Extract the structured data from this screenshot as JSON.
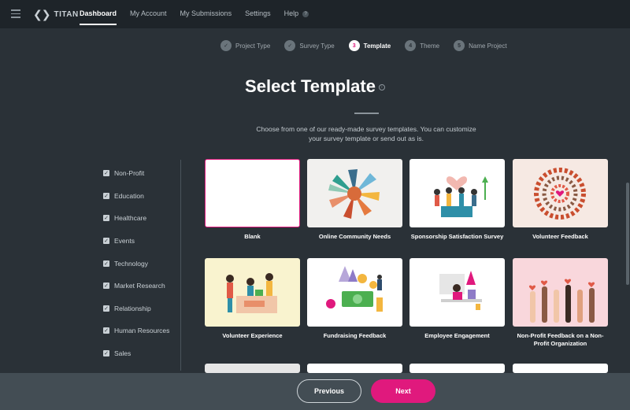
{
  "app": {
    "logo_text": "TITAN",
    "logo_mark": "❮❯"
  },
  "nav": {
    "items": [
      {
        "label": "Dashboard",
        "active": true
      },
      {
        "label": "My Account"
      },
      {
        "label": "My Submissions"
      },
      {
        "label": "Settings"
      },
      {
        "label": "Help"
      }
    ]
  },
  "stepper": {
    "steps": [
      {
        "label": "Project Type",
        "marker": "✓"
      },
      {
        "label": "Survey Type",
        "marker": "✓"
      },
      {
        "label": "Template",
        "marker": "3",
        "active": true
      },
      {
        "label": "Theme",
        "marker": "4"
      },
      {
        "label": "Name Project",
        "marker": "5"
      }
    ]
  },
  "page": {
    "title": "Select Template",
    "subtitle": "Choose from one of our ready-made survey templates. You can customize your survey template or send out as is."
  },
  "categories": [
    "Non-Profit",
    "Education",
    "Healthcare",
    "Events",
    "Technology",
    "Market Research",
    "Relationship",
    "Human Resources",
    "Sales"
  ],
  "templates": [
    {
      "label": "Blank"
    },
    {
      "label": "Online Community Needs"
    },
    {
      "label": "Sponsorship Satisfaction Survey"
    },
    {
      "label": "Volunteer Feedback"
    },
    {
      "label": "Volunteer Experience"
    },
    {
      "label": "Fundraising Feedback"
    },
    {
      "label": "Employee Engagement"
    },
    {
      "label": "Non-Profit Feedback on a Non-Profit Organization"
    }
  ],
  "footer": {
    "previous_label": "Previous",
    "next_label": "Next"
  },
  "colors": {
    "accent": "#e0197d",
    "background": "#2a3137",
    "topbar": "#1e2429",
    "footer": "#434d54"
  }
}
